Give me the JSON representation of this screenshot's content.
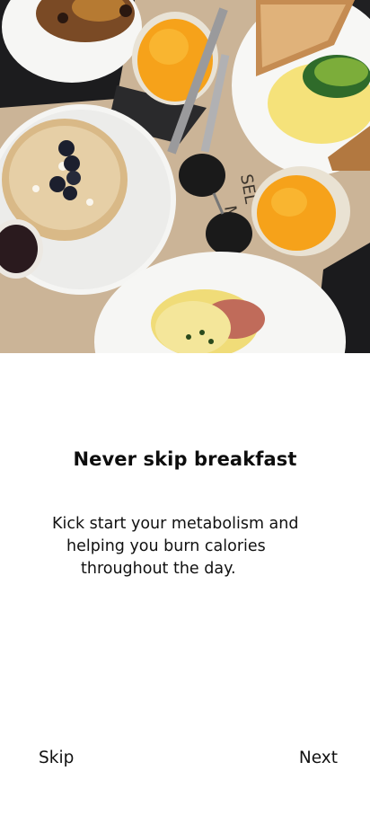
{
  "hero": {
    "image": "breakfast-table-photo"
  },
  "onboarding": {
    "title": "Never skip breakfast",
    "description_lines": [
      "Kick start your metabolism and",
      "helping you burn calories",
      "throughout the day."
    ]
  },
  "navigation": {
    "skip_label": "Skip",
    "next_label": "Next"
  },
  "colors": {
    "background": "#ffffff",
    "text": "#111111",
    "table": "#cdb69a",
    "plate": "#f7f7f5",
    "juice": "#f6a21a"
  }
}
